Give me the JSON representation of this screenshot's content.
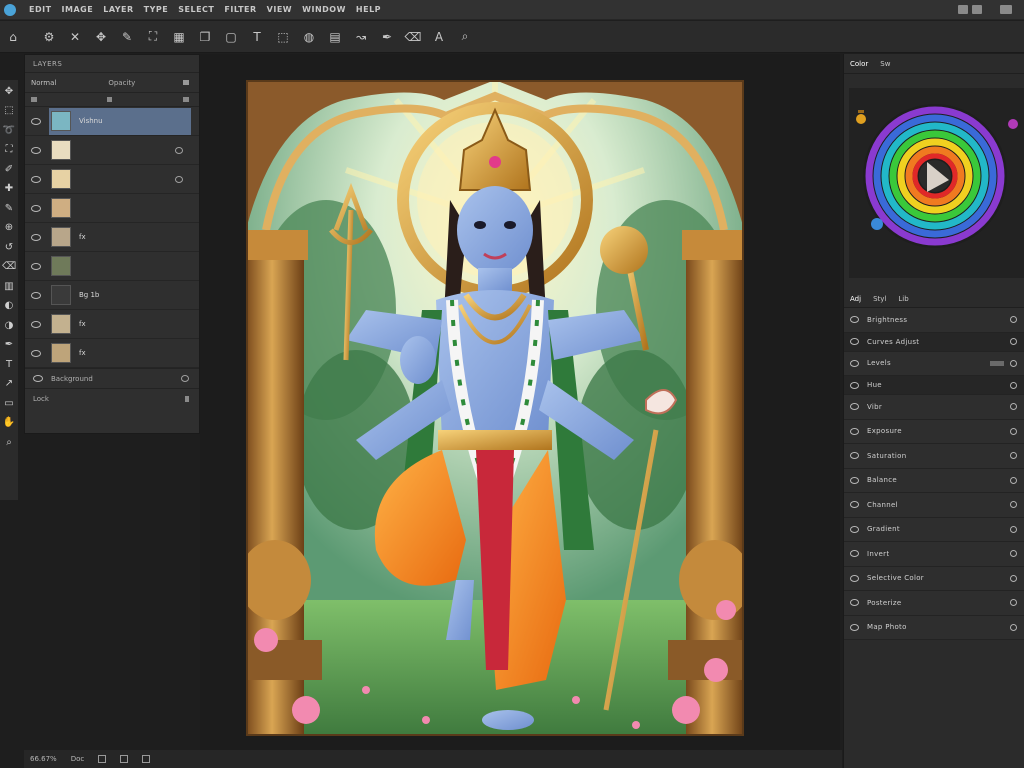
{
  "menu": {
    "items": [
      "EDIT",
      "IMAGE",
      "LAYER",
      "TYPE",
      "SELECT",
      "FILTER",
      "VIEW",
      "WINDOW",
      "HELP"
    ]
  },
  "options_toolbar": {
    "icons": [
      "home-icon",
      "gear-icon",
      "close-icon",
      "move-icon",
      "brush-icon",
      "crop-icon",
      "grid-icon",
      "layers-icon",
      "frame-icon",
      "type-icon",
      "select-icon",
      "fill-icon",
      "gradient-icon",
      "path-icon",
      "pen-icon",
      "eraser-icon",
      "text-icon",
      "zoom-icon"
    ]
  },
  "tools": {
    "icons": [
      "move-tool-icon",
      "marquee-tool-icon",
      "lasso-tool-icon",
      "crop-tool-icon",
      "eyedropper-tool-icon",
      "heal-tool-icon",
      "brush-tool-icon",
      "stamp-tool-icon",
      "history-tool-icon",
      "eraser-tool-icon",
      "gradient-tool-icon",
      "blur-tool-icon",
      "dodge-tool-icon",
      "pen-tool-icon",
      "type-tool-icon",
      "path-tool-icon",
      "shape-tool-icon",
      "hand-tool-icon",
      "zoom-tool-icon"
    ]
  },
  "layers_panel": {
    "title": "LAYERS",
    "blend_mode": "Normal",
    "opacity_label": "Opacity",
    "layers": [
      {
        "name": "Vishnu",
        "selected": true,
        "thumb": "#7bb6c2"
      },
      {
        "name": "",
        "selected": false,
        "thumb": "#e8dcc0"
      },
      {
        "name": "",
        "selected": false,
        "thumb": "#e7d2a4"
      },
      {
        "name": "",
        "selected": false,
        "thumb": "#cfae82"
      },
      {
        "name": "fx",
        "selected": false,
        "thumb": "#b8a68a"
      },
      {
        "name": "",
        "selected": false,
        "thumb": "#6f7a5a"
      },
      {
        "name": "Bg 1b",
        "selected": false,
        "thumb": "#3a3a3a"
      },
      {
        "name": "fx",
        "selected": false,
        "thumb": "#c3b18f"
      },
      {
        "name": "fx",
        "selected": false,
        "thumb": "#bea47a"
      }
    ],
    "footer_label": "Background",
    "bottom_label": "Lock"
  },
  "right_panel": {
    "tabs": [
      "Color",
      "Sw"
    ],
    "props_tabs": [
      "Adj",
      "Styl",
      "Lib"
    ],
    "rows": [
      {
        "label": "Brightness",
        "style": "normal"
      },
      {
        "label": "Curves Adjust",
        "style": "dark"
      },
      {
        "label": "Levels",
        "style": "normal"
      },
      {
        "label": "Hue",
        "style": "dark"
      },
      {
        "label": "Vibr",
        "style": "normal"
      },
      {
        "label": "Exposure",
        "style": "normal"
      },
      {
        "label": "Saturation",
        "style": "normal"
      },
      {
        "label": "Balance",
        "style": "normal"
      },
      {
        "label": "Channel",
        "style": "normal"
      },
      {
        "label": "Gradient",
        "style": "normal"
      },
      {
        "label": "Invert",
        "style": "normal"
      },
      {
        "label": "Selective Color",
        "style": "normal"
      },
      {
        "label": "Posterize",
        "style": "normal"
      },
      {
        "label": "Map Photo",
        "style": "normal"
      }
    ]
  },
  "status_bar": {
    "zoom": "66.67%",
    "items": [
      "Doc"
    ]
  },
  "colors": {
    "accent": "#5b6f8c",
    "panel": "#2f2f2f",
    "canvas": "#1c1c1c"
  }
}
